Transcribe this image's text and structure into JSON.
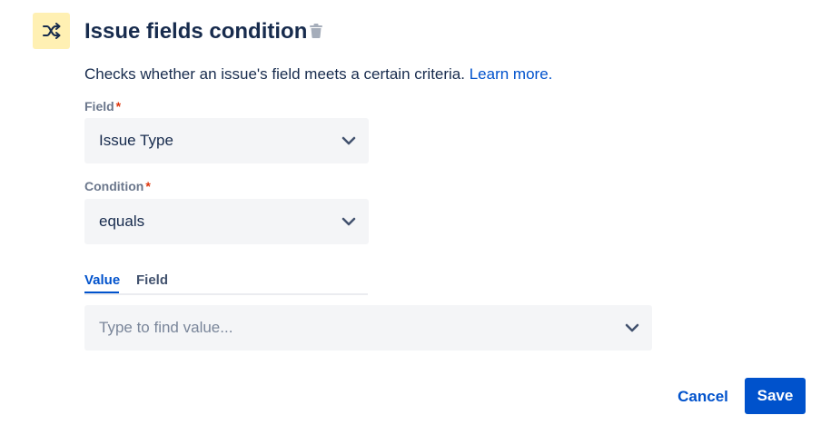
{
  "header": {
    "icon": "shuffle-icon",
    "title": "Issue fields condition",
    "delete_icon": "trash-icon"
  },
  "description": {
    "text": "Checks whether an issue's field meets a certain criteria.",
    "link": "Learn more."
  },
  "field": {
    "label": "Field",
    "required_marker": "*",
    "value": "Issue Type"
  },
  "condition": {
    "label": "Condition",
    "required_marker": "*",
    "value": "equals"
  },
  "tabs": [
    {
      "label": "Value",
      "active": true
    },
    {
      "label": "Field",
      "active": false
    }
  ],
  "value_input": {
    "placeholder": "Type to find value..."
  },
  "actions": {
    "cancel_label": "Cancel",
    "save_label": "Save"
  },
  "colors": {
    "accent": "#0052cc",
    "icon_bg": "#fff0b3",
    "required": "#de350b",
    "field_bg": "#f4f5f7"
  }
}
